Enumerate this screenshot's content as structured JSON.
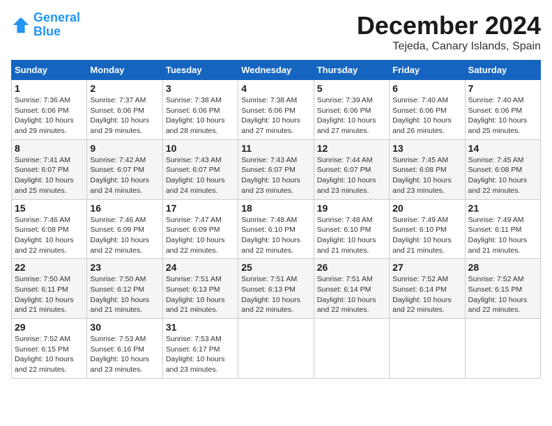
{
  "logo": {
    "line1": "General",
    "line2": "Blue"
  },
  "title": "December 2024",
  "location": "Tejeda, Canary Islands, Spain",
  "days_of_week": [
    "Sunday",
    "Monday",
    "Tuesday",
    "Wednesday",
    "Thursday",
    "Friday",
    "Saturday"
  ],
  "weeks": [
    [
      {
        "day": "1",
        "sunrise": "7:36 AM",
        "sunset": "6:06 PM",
        "daylight": "10 hours and 29 minutes."
      },
      {
        "day": "2",
        "sunrise": "7:37 AM",
        "sunset": "6:06 PM",
        "daylight": "10 hours and 29 minutes."
      },
      {
        "day": "3",
        "sunrise": "7:38 AM",
        "sunset": "6:06 PM",
        "daylight": "10 hours and 28 minutes."
      },
      {
        "day": "4",
        "sunrise": "7:38 AM",
        "sunset": "6:06 PM",
        "daylight": "10 hours and 27 minutes."
      },
      {
        "day": "5",
        "sunrise": "7:39 AM",
        "sunset": "6:06 PM",
        "daylight": "10 hours and 27 minutes."
      },
      {
        "day": "6",
        "sunrise": "7:40 AM",
        "sunset": "6:06 PM",
        "daylight": "10 hours and 26 minutes."
      },
      {
        "day": "7",
        "sunrise": "7:40 AM",
        "sunset": "6:06 PM",
        "daylight": "10 hours and 25 minutes."
      }
    ],
    [
      {
        "day": "8",
        "sunrise": "7:41 AM",
        "sunset": "6:07 PM",
        "daylight": "10 hours and 25 minutes."
      },
      {
        "day": "9",
        "sunrise": "7:42 AM",
        "sunset": "6:07 PM",
        "daylight": "10 hours and 24 minutes."
      },
      {
        "day": "10",
        "sunrise": "7:43 AM",
        "sunset": "6:07 PM",
        "daylight": "10 hours and 24 minutes."
      },
      {
        "day": "11",
        "sunrise": "7:43 AM",
        "sunset": "6:07 PM",
        "daylight": "10 hours and 23 minutes."
      },
      {
        "day": "12",
        "sunrise": "7:44 AM",
        "sunset": "6:07 PM",
        "daylight": "10 hours and 23 minutes."
      },
      {
        "day": "13",
        "sunrise": "7:45 AM",
        "sunset": "6:08 PM",
        "daylight": "10 hours and 23 minutes."
      },
      {
        "day": "14",
        "sunrise": "7:45 AM",
        "sunset": "6:08 PM",
        "daylight": "10 hours and 22 minutes."
      }
    ],
    [
      {
        "day": "15",
        "sunrise": "7:46 AM",
        "sunset": "6:08 PM",
        "daylight": "10 hours and 22 minutes."
      },
      {
        "day": "16",
        "sunrise": "7:46 AM",
        "sunset": "6:09 PM",
        "daylight": "10 hours and 22 minutes."
      },
      {
        "day": "17",
        "sunrise": "7:47 AM",
        "sunset": "6:09 PM",
        "daylight": "10 hours and 22 minutes."
      },
      {
        "day": "18",
        "sunrise": "7:48 AM",
        "sunset": "6:10 PM",
        "daylight": "10 hours and 22 minutes."
      },
      {
        "day": "19",
        "sunrise": "7:48 AM",
        "sunset": "6:10 PM",
        "daylight": "10 hours and 21 minutes."
      },
      {
        "day": "20",
        "sunrise": "7:49 AM",
        "sunset": "6:10 PM",
        "daylight": "10 hours and 21 minutes."
      },
      {
        "day": "21",
        "sunrise": "7:49 AM",
        "sunset": "6:11 PM",
        "daylight": "10 hours and 21 minutes."
      }
    ],
    [
      {
        "day": "22",
        "sunrise": "7:50 AM",
        "sunset": "6:11 PM",
        "daylight": "10 hours and 21 minutes."
      },
      {
        "day": "23",
        "sunrise": "7:50 AM",
        "sunset": "6:12 PM",
        "daylight": "10 hours and 21 minutes."
      },
      {
        "day": "24",
        "sunrise": "7:51 AM",
        "sunset": "6:13 PM",
        "daylight": "10 hours and 21 minutes."
      },
      {
        "day": "25",
        "sunrise": "7:51 AM",
        "sunset": "6:13 PM",
        "daylight": "10 hours and 22 minutes."
      },
      {
        "day": "26",
        "sunrise": "7:51 AM",
        "sunset": "6:14 PM",
        "daylight": "10 hours and 22 minutes."
      },
      {
        "day": "27",
        "sunrise": "7:52 AM",
        "sunset": "6:14 PM",
        "daylight": "10 hours and 22 minutes."
      },
      {
        "day": "28",
        "sunrise": "7:52 AM",
        "sunset": "6:15 PM",
        "daylight": "10 hours and 22 minutes."
      }
    ],
    [
      {
        "day": "29",
        "sunrise": "7:52 AM",
        "sunset": "6:15 PM",
        "daylight": "10 hours and 22 minutes."
      },
      {
        "day": "30",
        "sunrise": "7:53 AM",
        "sunset": "6:16 PM",
        "daylight": "10 hours and 23 minutes."
      },
      {
        "day": "31",
        "sunrise": "7:53 AM",
        "sunset": "6:17 PM",
        "daylight": "10 hours and 23 minutes."
      },
      null,
      null,
      null,
      null
    ]
  ]
}
